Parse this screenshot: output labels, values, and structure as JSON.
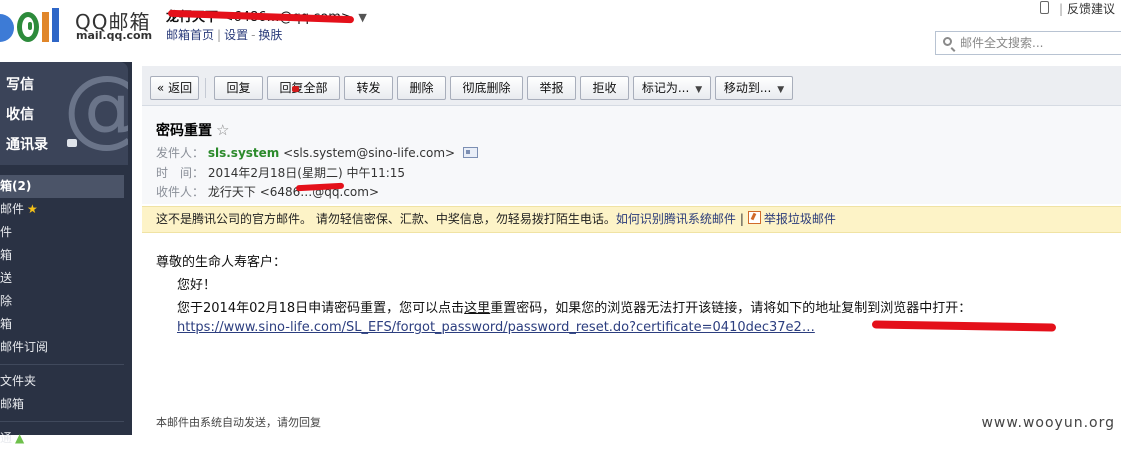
{
  "header": {
    "logo_text": "QQ邮箱",
    "logo_sub": "mail.qq.com",
    "account_name": "龙行天下",
    "account_email": "<6486…@qq.com>",
    "links": [
      "邮箱首页",
      "设置",
      "换肤"
    ],
    "feedback": "反馈建议",
    "search_placeholder": "邮件全文搜索..."
  },
  "sidebar": {
    "compose": "写信",
    "inbox": "收信",
    "contacts": "通讯录",
    "items": [
      "箱(2)",
      "邮件",
      "件",
      "箱",
      "送",
      "除",
      "箱",
      "邮件订阅",
      "文件夹",
      "邮箱",
      "通"
    ]
  },
  "toolbar": {
    "back": "« 返回",
    "reply": "回复",
    "reply_all": "回复全部",
    "forward": "转发",
    "delete": "删除",
    "delete_perm": "彻底删除",
    "report": "举报",
    "reject": "拒收",
    "mark_as": "标记为...",
    "move_to": "移动到..."
  },
  "email": {
    "subject": "密码重置",
    "from_label": "发件人：",
    "from_name": "sls.system",
    "from_addr": "<sls.system@sino-life.com>",
    "time_label": "时　间：",
    "time_value": "2014年2月18日(星期二) 中午11:15",
    "to_label": "收件人：",
    "to_name": "龙行天下",
    "to_addr": "<6486…@qq.com>"
  },
  "warning": {
    "text": "这不是腾讯公司的官方邮件。 请勿轻信密保、汇款、中奖信息，勿轻易拨打陌生电话。",
    "link": "如何识别腾讯系统邮件",
    "report": "举报垃圾邮件"
  },
  "body": {
    "greeting": "尊敬的生命人寿客户：",
    "hello": "您好！",
    "para_pre": "您于2014年02月18日申请密码重置，您可以点击",
    "para_link": "这里",
    "para_post": "重置密码，如果您的浏览器无法打开该链接，请将如下的地址复制到浏览器中打开：",
    "reset_url": "https://www.sino-life.com/SL_EFS/forgot_password/password_reset.do?certificate=0410dec37e2…",
    "auto_note": "本邮件由系统自动发送，请勿回复"
  },
  "watermark": "www.wooyun.org"
}
